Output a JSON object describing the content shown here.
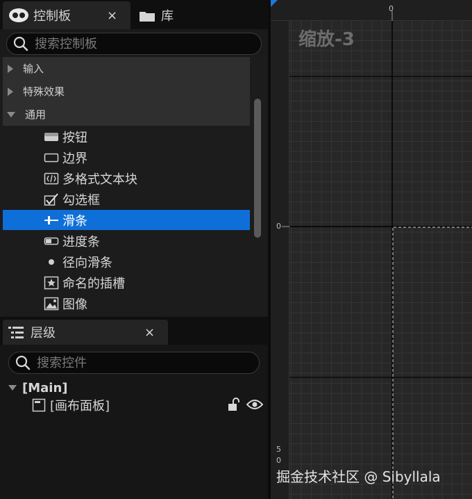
{
  "palette": {
    "tab_title": "控制板",
    "close_glyph": "×",
    "library_tab": "库",
    "search_placeholder": "搜索控制板",
    "categories": [
      {
        "label": "输入",
        "expanded": false
      },
      {
        "label": "特殊效果",
        "expanded": false
      },
      {
        "label": "通用",
        "expanded": true
      }
    ],
    "items": [
      {
        "label": "按钮",
        "icon": "button-icon"
      },
      {
        "label": "边界",
        "icon": "border-icon"
      },
      {
        "label": "多格式文本块",
        "icon": "rich-text-icon"
      },
      {
        "label": "勾选框",
        "icon": "checkbox-icon"
      },
      {
        "label": "滑条",
        "icon": "slider-icon",
        "selected": true
      },
      {
        "label": "进度条",
        "icon": "progress-bar-icon"
      },
      {
        "label": "径向滑条",
        "icon": "radial-slider-icon"
      },
      {
        "label": "命名的插槽",
        "icon": "named-slot-icon"
      },
      {
        "label": "图像",
        "icon": "image-icon"
      }
    ]
  },
  "hierarchy": {
    "tab_title": "层级",
    "close_glyph": "×",
    "search_placeholder": "搜索控件",
    "root_label": "[Main]",
    "child_label": "[画布面板]"
  },
  "canvas": {
    "zoom_label": "缩放-3",
    "ruler_top_zero": "0",
    "ruler_left_zero": "0",
    "ruler_left_five": "5",
    "ruler_left_zero_bottom": "0"
  },
  "watermark": "掘金技术社区 @ Sibyllala",
  "colors": {
    "selection": "#0e6fd8",
    "background": "#1a1a1a"
  }
}
